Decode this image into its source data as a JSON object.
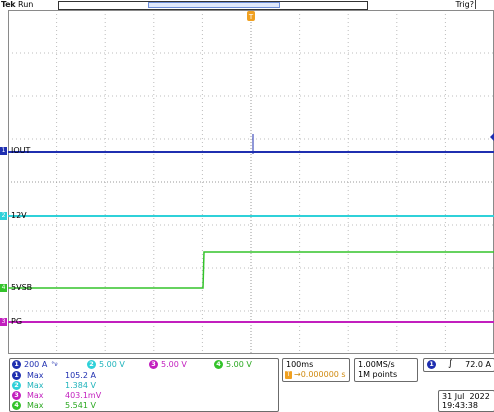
{
  "header": {
    "brand": "Tek",
    "status": "Run",
    "trigger_status": "Trig?"
  },
  "channels": [
    {
      "id": "1",
      "marker": "1",
      "label": "IOUT",
      "color": "#1f2fb0"
    },
    {
      "id": "2",
      "marker": "2",
      "label": "12V",
      "color": "#2fd1d9"
    },
    {
      "id": "3",
      "marker": "3",
      "label": "PG",
      "color": "#c21fbe"
    },
    {
      "id": "4",
      "marker": "4",
      "label": "5VSB",
      "color": "#33c32a"
    }
  ],
  "vertical_scales": [
    {
      "ch": "1",
      "value": "200 A",
      "suffix": "°ν"
    },
    {
      "ch": "2",
      "value": "5.00 V",
      "suffix": ""
    },
    {
      "ch": "3",
      "value": "5.00 V",
      "suffix": ""
    },
    {
      "ch": "4",
      "value": "5.00 V",
      "suffix": ""
    }
  ],
  "measurements": [
    {
      "ch": "1",
      "type": "Max",
      "value": "105.2 A"
    },
    {
      "ch": "2",
      "type": "Max",
      "value": "1.384 V"
    },
    {
      "ch": "3",
      "type": "Max",
      "value": "403.1mV"
    },
    {
      "ch": "4",
      "type": "Max",
      "value": "5.541 V"
    }
  ],
  "timebase": {
    "scale": "100ms",
    "position": "0.000000 s"
  },
  "acquisition": {
    "rate": "1.00MS/s",
    "points": "1M points"
  },
  "trigger": {
    "source": "1",
    "slope": "rising",
    "level": "72.0 A"
  },
  "datetime": {
    "date": "31 Jul  2022",
    "time": "19:43:38"
  },
  "colors": {
    "ch1": "#1f2fb0",
    "ch2": "#2fd1d9",
    "ch3": "#c21fbe",
    "ch4": "#33c32a",
    "trigger_marker": "#f0a020",
    "grid": "#bdbdbd"
  }
}
